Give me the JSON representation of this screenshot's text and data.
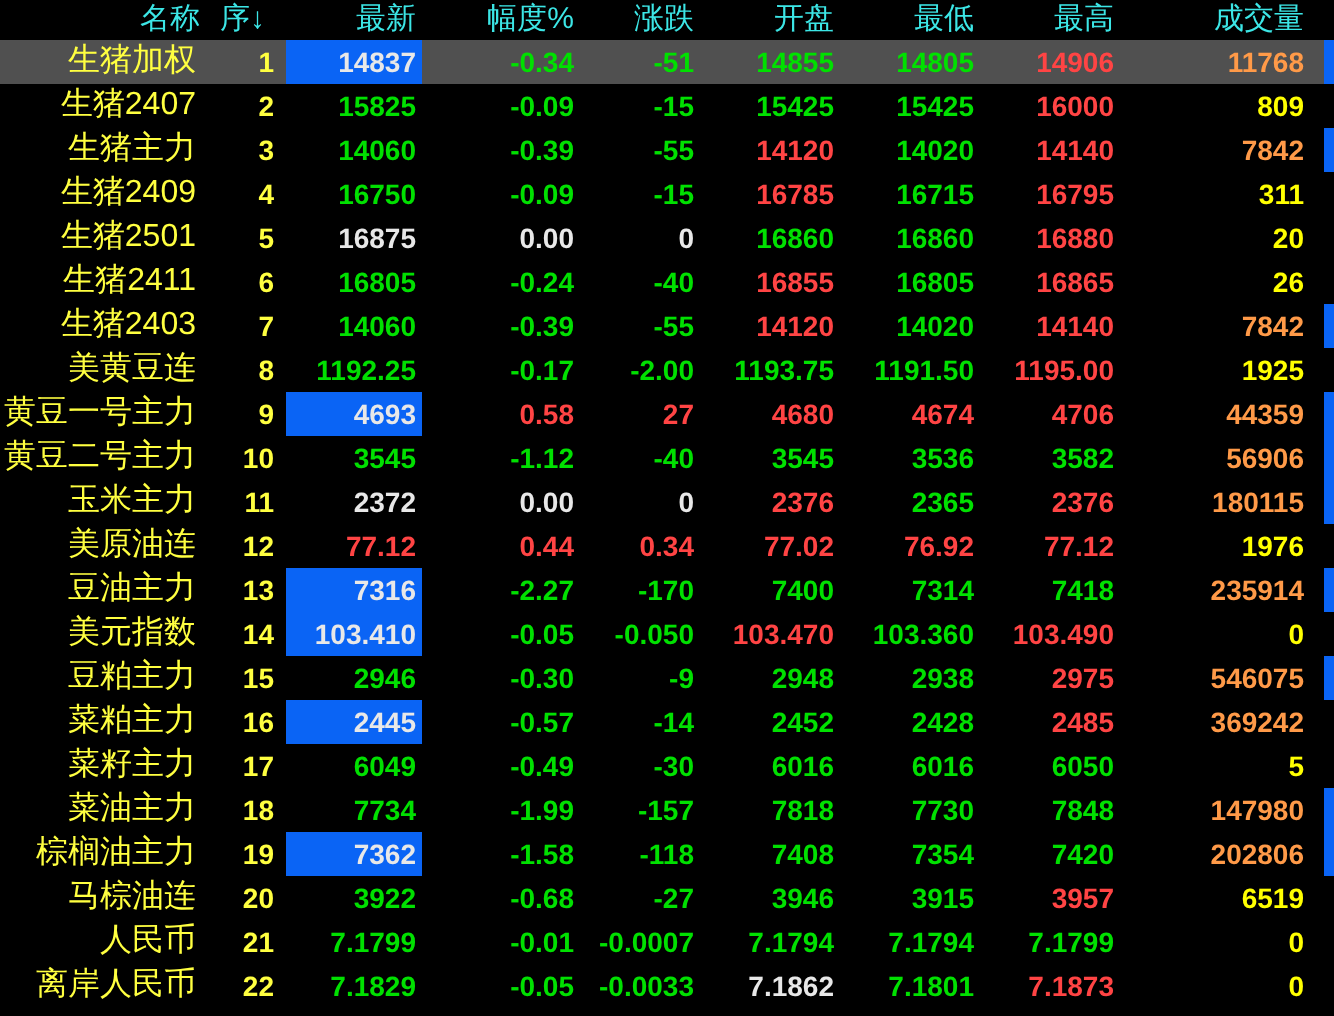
{
  "columns": [
    "名称",
    "序↓",
    "最新",
    "幅度%",
    "涨跌",
    "开盘",
    "最低",
    "最高",
    "成交量"
  ],
  "rows": [
    {
      "name": "生猪加权",
      "seq": "1",
      "selected": true,
      "flash": true,
      "marker": true,
      "cells": [
        {
          "text": "14837",
          "up": false,
          "down": false
        },
        {
          "text": "-0.34",
          "up": false,
          "down": true
        },
        {
          "text": "-51",
          "up": false,
          "down": true
        },
        {
          "text": "14855",
          "up": false,
          "down": true
        },
        {
          "text": "14805",
          "up": false,
          "down": true
        },
        {
          "text": "14906",
          "up": true,
          "down": false
        },
        {
          "text": "11768",
          "large": true
        }
      ]
    },
    {
      "name": "生猪2407",
      "seq": "2",
      "selected": false,
      "flash": false,
      "marker": false,
      "cells": [
        {
          "text": "15825",
          "up": false,
          "down": true
        },
        {
          "text": "-0.09",
          "up": false,
          "down": true
        },
        {
          "text": "-15",
          "up": false,
          "down": true
        },
        {
          "text": "15425",
          "up": false,
          "down": true
        },
        {
          "text": "15425",
          "up": false,
          "down": true
        },
        {
          "text": "16000",
          "up": true,
          "down": false
        },
        {
          "text": "809",
          "large": false
        }
      ]
    },
    {
      "name": "生猪主力",
      "seq": "3",
      "selected": false,
      "flash": false,
      "marker": true,
      "cells": [
        {
          "text": "14060",
          "up": false,
          "down": true
        },
        {
          "text": "-0.39",
          "up": false,
          "down": true
        },
        {
          "text": "-55",
          "up": false,
          "down": true
        },
        {
          "text": "14120",
          "up": true,
          "down": false
        },
        {
          "text": "14020",
          "up": false,
          "down": true
        },
        {
          "text": "14140",
          "up": true,
          "down": false
        },
        {
          "text": "7842",
          "large": true
        }
      ]
    },
    {
      "name": "生猪2409",
      "seq": "4",
      "selected": false,
      "flash": false,
      "marker": false,
      "cells": [
        {
          "text": "16750",
          "up": false,
          "down": true
        },
        {
          "text": "-0.09",
          "up": false,
          "down": true
        },
        {
          "text": "-15",
          "up": false,
          "down": true
        },
        {
          "text": "16785",
          "up": true,
          "down": false
        },
        {
          "text": "16715",
          "up": false,
          "down": true
        },
        {
          "text": "16795",
          "up": true,
          "down": false
        },
        {
          "text": "311",
          "large": false
        }
      ]
    },
    {
      "name": "生猪2501",
      "seq": "5",
      "selected": false,
      "flash": false,
      "marker": false,
      "cells": [
        {
          "text": "16875",
          "up": false,
          "down": false
        },
        {
          "text": "0.00",
          "up": false,
          "down": false
        },
        {
          "text": "0",
          "up": false,
          "down": false
        },
        {
          "text": "16860",
          "up": false,
          "down": true
        },
        {
          "text": "16860",
          "up": false,
          "down": true
        },
        {
          "text": "16880",
          "up": true,
          "down": false
        },
        {
          "text": "20",
          "large": false
        }
      ]
    },
    {
      "name": "生猪2411",
      "seq": "6",
      "selected": false,
      "flash": false,
      "marker": false,
      "cells": [
        {
          "text": "16805",
          "up": false,
          "down": true
        },
        {
          "text": "-0.24",
          "up": false,
          "down": true
        },
        {
          "text": "-40",
          "up": false,
          "down": true
        },
        {
          "text": "16855",
          "up": true,
          "down": false
        },
        {
          "text": "16805",
          "up": false,
          "down": true
        },
        {
          "text": "16865",
          "up": true,
          "down": false
        },
        {
          "text": "26",
          "large": false
        }
      ]
    },
    {
      "name": "生猪2403",
      "seq": "7",
      "selected": false,
      "flash": false,
      "marker": true,
      "cells": [
        {
          "text": "14060",
          "up": false,
          "down": true
        },
        {
          "text": "-0.39",
          "up": false,
          "down": true
        },
        {
          "text": "-55",
          "up": false,
          "down": true
        },
        {
          "text": "14120",
          "up": true,
          "down": false
        },
        {
          "text": "14020",
          "up": false,
          "down": true
        },
        {
          "text": "14140",
          "up": true,
          "down": false
        },
        {
          "text": "7842",
          "large": true
        }
      ]
    },
    {
      "name": "美黄豆连",
      "seq": "8",
      "selected": false,
      "flash": false,
      "marker": false,
      "cells": [
        {
          "text": "1192.25",
          "up": false,
          "down": true
        },
        {
          "text": "-0.17",
          "up": false,
          "down": true
        },
        {
          "text": "-2.00",
          "up": false,
          "down": true
        },
        {
          "text": "1193.75",
          "up": false,
          "down": true
        },
        {
          "text": "1191.50",
          "up": false,
          "down": true
        },
        {
          "text": "1195.00",
          "up": true,
          "down": false
        },
        {
          "text": "1925",
          "large": false
        }
      ]
    },
    {
      "name": "黄豆一号主力",
      "seq": "9",
      "selected": false,
      "flash": true,
      "marker": true,
      "cells": [
        {
          "text": "4693",
          "up": false,
          "down": false
        },
        {
          "text": "0.58",
          "up": true,
          "down": false
        },
        {
          "text": "27",
          "up": true,
          "down": false
        },
        {
          "text": "4680",
          "up": true,
          "down": false
        },
        {
          "text": "4674",
          "up": true,
          "down": false
        },
        {
          "text": "4706",
          "up": true,
          "down": false
        },
        {
          "text": "44359",
          "large": true
        }
      ]
    },
    {
      "name": "黄豆二号主力",
      "seq": "10",
      "selected": false,
      "flash": false,
      "marker": true,
      "cells": [
        {
          "text": "3545",
          "up": false,
          "down": true
        },
        {
          "text": "-1.12",
          "up": false,
          "down": true
        },
        {
          "text": "-40",
          "up": false,
          "down": true
        },
        {
          "text": "3545",
          "up": false,
          "down": true
        },
        {
          "text": "3536",
          "up": false,
          "down": true
        },
        {
          "text": "3582",
          "up": false,
          "down": true
        },
        {
          "text": "56906",
          "large": true
        }
      ]
    },
    {
      "name": "玉米主力",
      "seq": "11",
      "selected": false,
      "flash": false,
      "marker": true,
      "cells": [
        {
          "text": "2372",
          "up": false,
          "down": false
        },
        {
          "text": "0.00",
          "up": false,
          "down": false
        },
        {
          "text": "0",
          "up": false,
          "down": false
        },
        {
          "text": "2376",
          "up": true,
          "down": false
        },
        {
          "text": "2365",
          "up": false,
          "down": true
        },
        {
          "text": "2376",
          "up": true,
          "down": false
        },
        {
          "text": "180115",
          "large": true
        }
      ]
    },
    {
      "name": "美原油连",
      "seq": "12",
      "selected": false,
      "flash": false,
      "marker": false,
      "cells": [
        {
          "text": "77.12",
          "up": true,
          "down": false
        },
        {
          "text": "0.44",
          "up": true,
          "down": false
        },
        {
          "text": "0.34",
          "up": true,
          "down": false
        },
        {
          "text": "77.02",
          "up": true,
          "down": false
        },
        {
          "text": "76.92",
          "up": true,
          "down": false
        },
        {
          "text": "77.12",
          "up": true,
          "down": false
        },
        {
          "text": "1976",
          "large": false
        }
      ]
    },
    {
      "name": "豆油主力",
      "seq": "13",
      "selected": false,
      "flash": true,
      "marker": true,
      "cells": [
        {
          "text": "7316",
          "up": false,
          "down": false
        },
        {
          "text": "-2.27",
          "up": false,
          "down": true
        },
        {
          "text": "-170",
          "up": false,
          "down": true
        },
        {
          "text": "7400",
          "up": false,
          "down": true
        },
        {
          "text": "7314",
          "up": false,
          "down": true
        },
        {
          "text": "7418",
          "up": false,
          "down": true
        },
        {
          "text": "235914",
          "large": true
        }
      ]
    },
    {
      "name": "美元指数",
      "seq": "14",
      "selected": false,
      "flash": true,
      "marker": false,
      "cells": [
        {
          "text": "103.410",
          "up": false,
          "down": false
        },
        {
          "text": "-0.05",
          "up": false,
          "down": true
        },
        {
          "text": "-0.050",
          "up": false,
          "down": true
        },
        {
          "text": "103.470",
          "up": true,
          "down": false
        },
        {
          "text": "103.360",
          "up": false,
          "down": true
        },
        {
          "text": "103.490",
          "up": true,
          "down": false
        },
        {
          "text": "0",
          "large": false
        }
      ]
    },
    {
      "name": "豆粕主力",
      "seq": "15",
      "selected": false,
      "flash": false,
      "marker": true,
      "cells": [
        {
          "text": "2946",
          "up": false,
          "down": true
        },
        {
          "text": "-0.30",
          "up": false,
          "down": true
        },
        {
          "text": "-9",
          "up": false,
          "down": true
        },
        {
          "text": "2948",
          "up": false,
          "down": true
        },
        {
          "text": "2938",
          "up": false,
          "down": true
        },
        {
          "text": "2975",
          "up": true,
          "down": false
        },
        {
          "text": "546075",
          "large": true
        }
      ]
    },
    {
      "name": "菜粕主力",
      "seq": "16",
      "selected": false,
      "flash": true,
      "marker": false,
      "cells": [
        {
          "text": "2445",
          "up": false,
          "down": false
        },
        {
          "text": "-0.57",
          "up": false,
          "down": true
        },
        {
          "text": "-14",
          "up": false,
          "down": true
        },
        {
          "text": "2452",
          "up": false,
          "down": true
        },
        {
          "text": "2428",
          "up": false,
          "down": true
        },
        {
          "text": "2485",
          "up": true,
          "down": false
        },
        {
          "text": "369242",
          "large": true
        }
      ]
    },
    {
      "name": "菜籽主力",
      "seq": "17",
      "selected": false,
      "flash": false,
      "marker": false,
      "cells": [
        {
          "text": "6049",
          "up": false,
          "down": true
        },
        {
          "text": "-0.49",
          "up": false,
          "down": true
        },
        {
          "text": "-30",
          "up": false,
          "down": true
        },
        {
          "text": "6016",
          "up": false,
          "down": true
        },
        {
          "text": "6016",
          "up": false,
          "down": true
        },
        {
          "text": "6050",
          "up": false,
          "down": true
        },
        {
          "text": "5",
          "large": false
        }
      ]
    },
    {
      "name": "菜油主力",
      "seq": "18",
      "selected": false,
      "flash": false,
      "marker": true,
      "cells": [
        {
          "text": "7734",
          "up": false,
          "down": true
        },
        {
          "text": "-1.99",
          "up": false,
          "down": true
        },
        {
          "text": "-157",
          "up": false,
          "down": true
        },
        {
          "text": "7818",
          "up": false,
          "down": true
        },
        {
          "text": "7730",
          "up": false,
          "down": true
        },
        {
          "text": "7848",
          "up": false,
          "down": true
        },
        {
          "text": "147980",
          "large": true
        }
      ]
    },
    {
      "name": "棕榈油主力",
      "seq": "19",
      "selected": false,
      "flash": true,
      "marker": true,
      "cells": [
        {
          "text": "7362",
          "up": false,
          "down": false
        },
        {
          "text": "-1.58",
          "up": false,
          "down": true
        },
        {
          "text": "-118",
          "up": false,
          "down": true
        },
        {
          "text": "7408",
          "up": false,
          "down": true
        },
        {
          "text": "7354",
          "up": false,
          "down": true
        },
        {
          "text": "7420",
          "up": false,
          "down": true
        },
        {
          "text": "202806",
          "large": true
        }
      ]
    },
    {
      "name": "马棕油连",
      "seq": "20",
      "selected": false,
      "flash": false,
      "marker": false,
      "cells": [
        {
          "text": "3922",
          "up": false,
          "down": true
        },
        {
          "text": "-0.68",
          "up": false,
          "down": true
        },
        {
          "text": "-27",
          "up": false,
          "down": true
        },
        {
          "text": "3946",
          "up": false,
          "down": true
        },
        {
          "text": "3915",
          "up": false,
          "down": true
        },
        {
          "text": "3957",
          "up": true,
          "down": false
        },
        {
          "text": "6519",
          "large": false
        }
      ]
    },
    {
      "name": "人民币",
      "seq": "21",
      "selected": false,
      "flash": false,
      "marker": false,
      "cells": [
        {
          "text": "7.1799",
          "up": false,
          "down": true
        },
        {
          "text": "-0.01",
          "up": false,
          "down": true
        },
        {
          "text": "-0.0007",
          "up": false,
          "down": true
        },
        {
          "text": "7.1794",
          "up": false,
          "down": true
        },
        {
          "text": "7.1794",
          "up": false,
          "down": true
        },
        {
          "text": "7.1799",
          "up": false,
          "down": true
        },
        {
          "text": "0",
          "large": false
        }
      ]
    },
    {
      "name": "离岸人民币",
      "seq": "22",
      "selected": false,
      "flash": false,
      "marker": false,
      "cells": [
        {
          "text": "7.1829",
          "up": false,
          "down": true
        },
        {
          "text": "-0.05",
          "up": false,
          "down": true
        },
        {
          "text": "-0.0033",
          "up": false,
          "down": true
        },
        {
          "text": "7.1862",
          "up": false,
          "down": false
        },
        {
          "text": "7.1801",
          "up": false,
          "down": true
        },
        {
          "text": "7.1873",
          "up": true,
          "down": false
        },
        {
          "text": "0",
          "large": false
        }
      ]
    }
  ]
}
